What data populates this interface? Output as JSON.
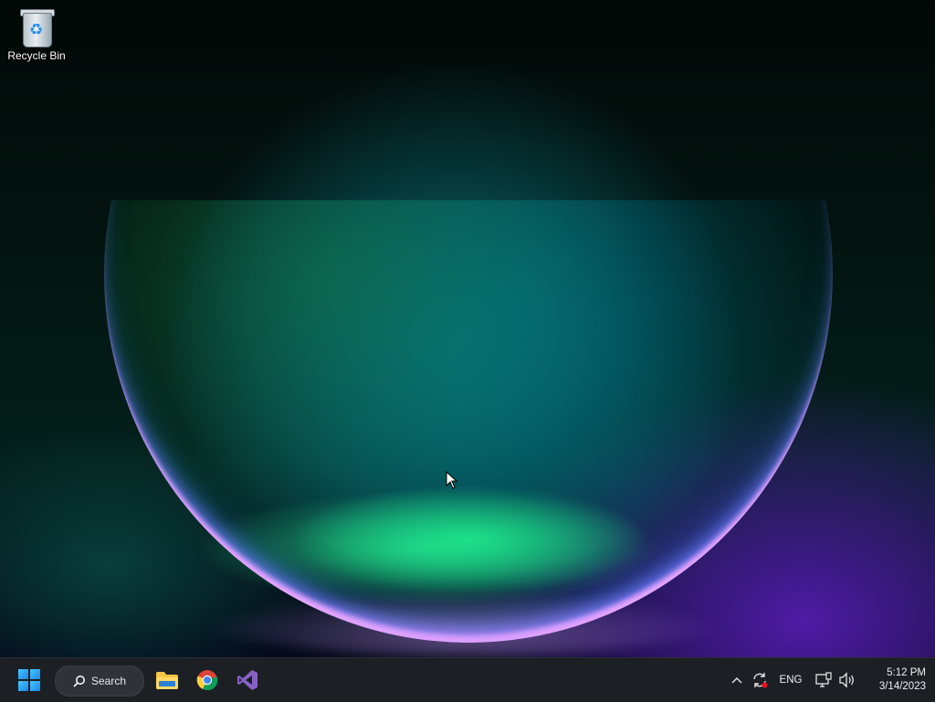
{
  "desktop": {
    "icons": [
      {
        "label": "Recycle Bin",
        "icon": "recycle-bin-icon"
      }
    ]
  },
  "taskbar": {
    "start_icon": "windows-logo-icon",
    "search": {
      "label": "Search",
      "icon": "search-icon"
    },
    "pinned_apps": [
      {
        "name": "File Explorer",
        "icon": "folder-icon"
      },
      {
        "name": "Google Chrome",
        "icon": "chrome-icon"
      },
      {
        "name": "Visual Studio",
        "icon": "visual-studio-icon"
      }
    ],
    "tray": {
      "chevron_icon": "chevron-up-icon",
      "sync_icon": "sync-icon",
      "language": "ENG",
      "network_icon": "network-icon",
      "volume_icon": "speaker-icon",
      "time": "5:12 PM",
      "date": "3/14/2023"
    }
  },
  "colors": {
    "taskbar_bg": "#1c1f24",
    "accent": "#1a86e6"
  }
}
